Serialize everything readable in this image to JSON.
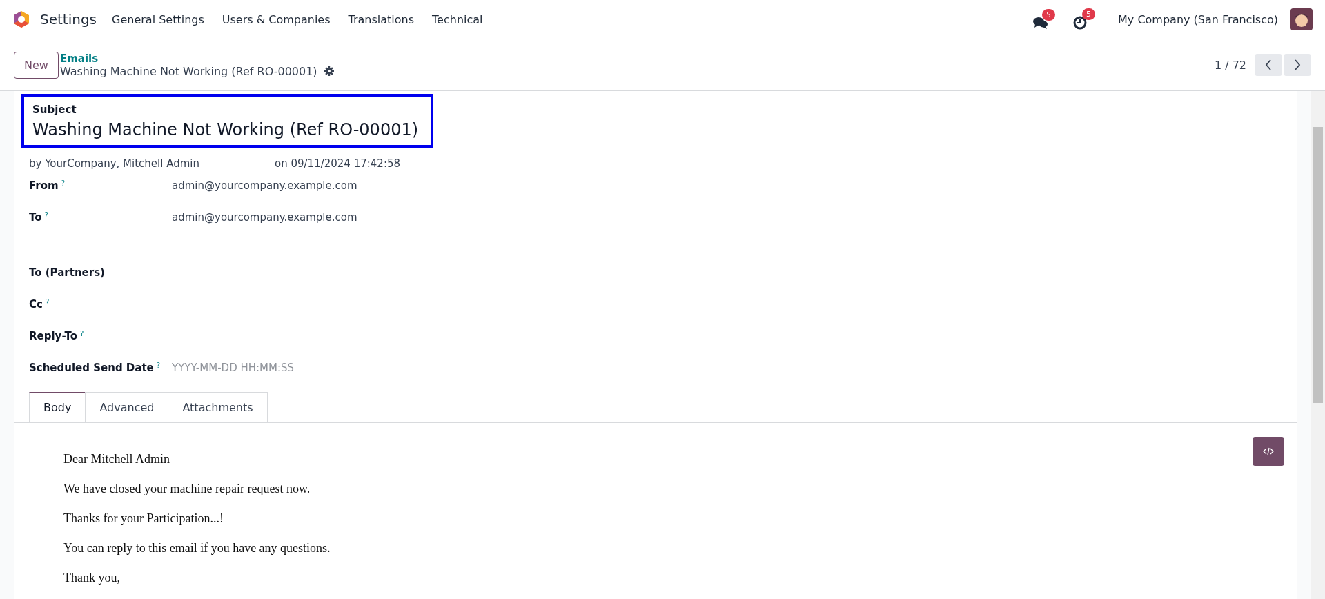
{
  "navbar": {
    "app_title": "Settings",
    "menu": [
      "General Settings",
      "Users & Companies",
      "Translations",
      "Technical"
    ],
    "messages_count": "5",
    "activities_count": "5",
    "company": "My Company (San Francisco)"
  },
  "control_panel": {
    "new_button": "New",
    "breadcrumb": "Emails",
    "record_title": "Washing Machine Not Working (Ref RO-00001)",
    "pager": "1 / 72"
  },
  "form": {
    "subject_label": "Subject",
    "subject": "Washing Machine Not Working (Ref RO-00001)",
    "author": "by YourCompany, Mitchell Admin",
    "date": "on 09/11/2024 17:42:58",
    "fields": [
      {
        "label": "From",
        "help": "?",
        "value": "admin@yourcompany.example.com"
      },
      {
        "label": "To",
        "help": "?",
        "value": "admin@yourcompany.example.com"
      },
      {
        "label": "To (Partners)"
      },
      {
        "label": "Cc",
        "help": "?"
      },
      {
        "label": "Reply-To",
        "help": "?"
      },
      {
        "label": "Scheduled Send Date",
        "help": "?",
        "placeholder": "YYYY-MM-DD HH:MM:SS"
      }
    ],
    "tabs": [
      {
        "label": "Body",
        "selected": true
      },
      {
        "label": "Advanced",
        "selected": false
      },
      {
        "label": "Attachments",
        "selected": false
      }
    ],
    "body": [
      "Dear Mitchell Admin",
      "We have closed your machine repair request now.",
      "Thanks for your Participation...!",
      "You can reply to this email if you have any questions.",
      "Thank you,"
    ]
  }
}
